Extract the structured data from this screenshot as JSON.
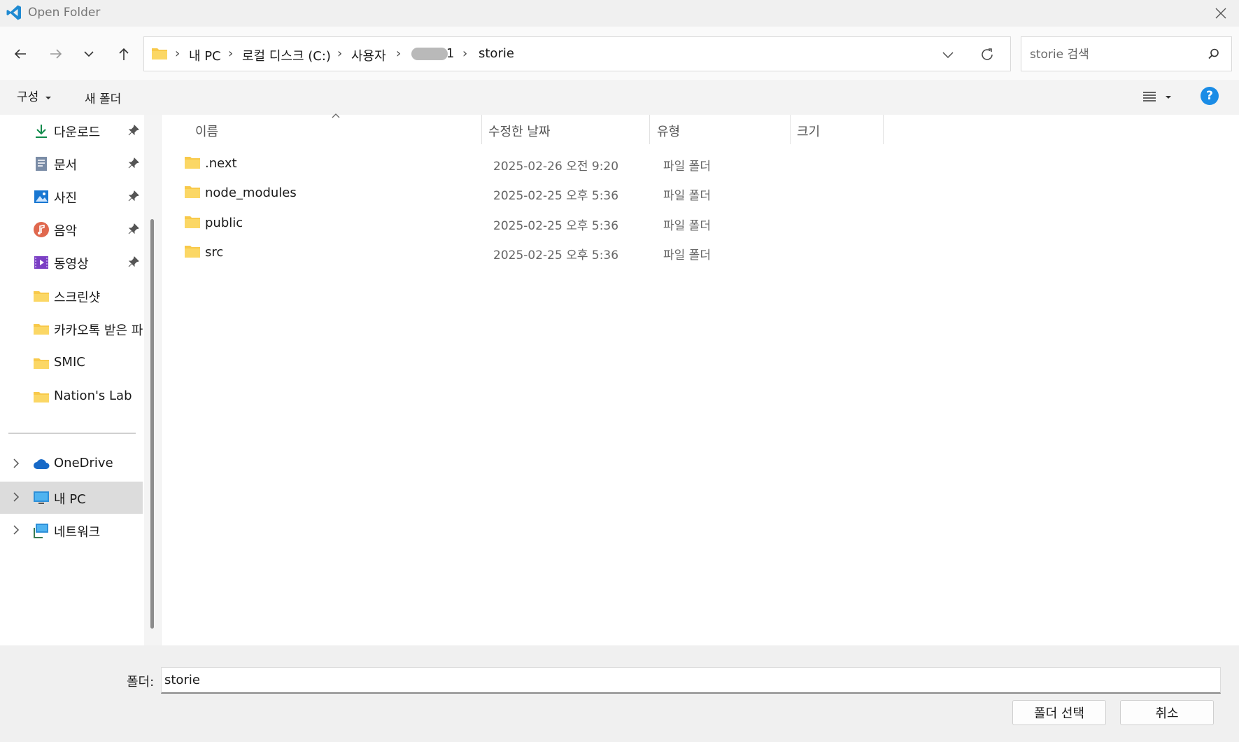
{
  "window": {
    "title": "Open Folder"
  },
  "nav": {
    "back": "back-arrow",
    "forward": "forward-arrow",
    "recent": "chevron-down",
    "up": "up-arrow"
  },
  "breadcrumb": {
    "items": [
      "내 PC",
      "로컬 디스크 (C:)",
      "사용자",
      "1",
      "storie"
    ]
  },
  "search": {
    "placeholder": "storie 검색"
  },
  "toolbar": {
    "organize": "구성",
    "new_folder": "새 폴더"
  },
  "sidebar": {
    "quick": [
      {
        "label": "다운로드",
        "icon": "download-icon",
        "pinned": true
      },
      {
        "label": "문서",
        "icon": "document-icon",
        "pinned": true
      },
      {
        "label": "사진",
        "icon": "picture-icon",
        "pinned": true
      },
      {
        "label": "음악",
        "icon": "music-icon",
        "pinned": true
      },
      {
        "label": "동영상",
        "icon": "video-icon",
        "pinned": true
      },
      {
        "label": "스크린샷",
        "icon": "folder-icon",
        "pinned": false
      },
      {
        "label": "카카오톡 받은 파",
        "icon": "folder-icon",
        "pinned": false
      },
      {
        "label": "SMIC",
        "icon": "folder-icon",
        "pinned": false
      },
      {
        "label": "Nation's Lab",
        "icon": "folder-icon",
        "pinned": false
      }
    ],
    "roots": [
      {
        "label": "OneDrive",
        "icon": "cloud-icon"
      },
      {
        "label": "내 PC",
        "icon": "monitor-icon",
        "selected": true
      },
      {
        "label": "네트워크",
        "icon": "network-icon"
      }
    ]
  },
  "columns": {
    "name": "이름",
    "modified": "수정한 날짜",
    "type": "유형",
    "size": "크기"
  },
  "files": [
    {
      "name": ".next",
      "modified": "2025-02-26 오전 9:20",
      "type": "파일 폴더"
    },
    {
      "name": "node_modules",
      "modified": "2025-02-25 오후 5:36",
      "type": "파일 폴더"
    },
    {
      "name": "public",
      "modified": "2025-02-25 오후 5:36",
      "type": "파일 폴더"
    },
    {
      "name": "src",
      "modified": "2025-02-25 오후 5:36",
      "type": "파일 폴더"
    }
  ],
  "footer": {
    "folder_label": "폴더:",
    "folder_value": "storie",
    "select_button": "폴더 선택",
    "cancel_button": "취소"
  },
  "colors": {
    "folder": "#f8c94a",
    "accent": "#0067c0",
    "help": "#1a8ce6"
  }
}
